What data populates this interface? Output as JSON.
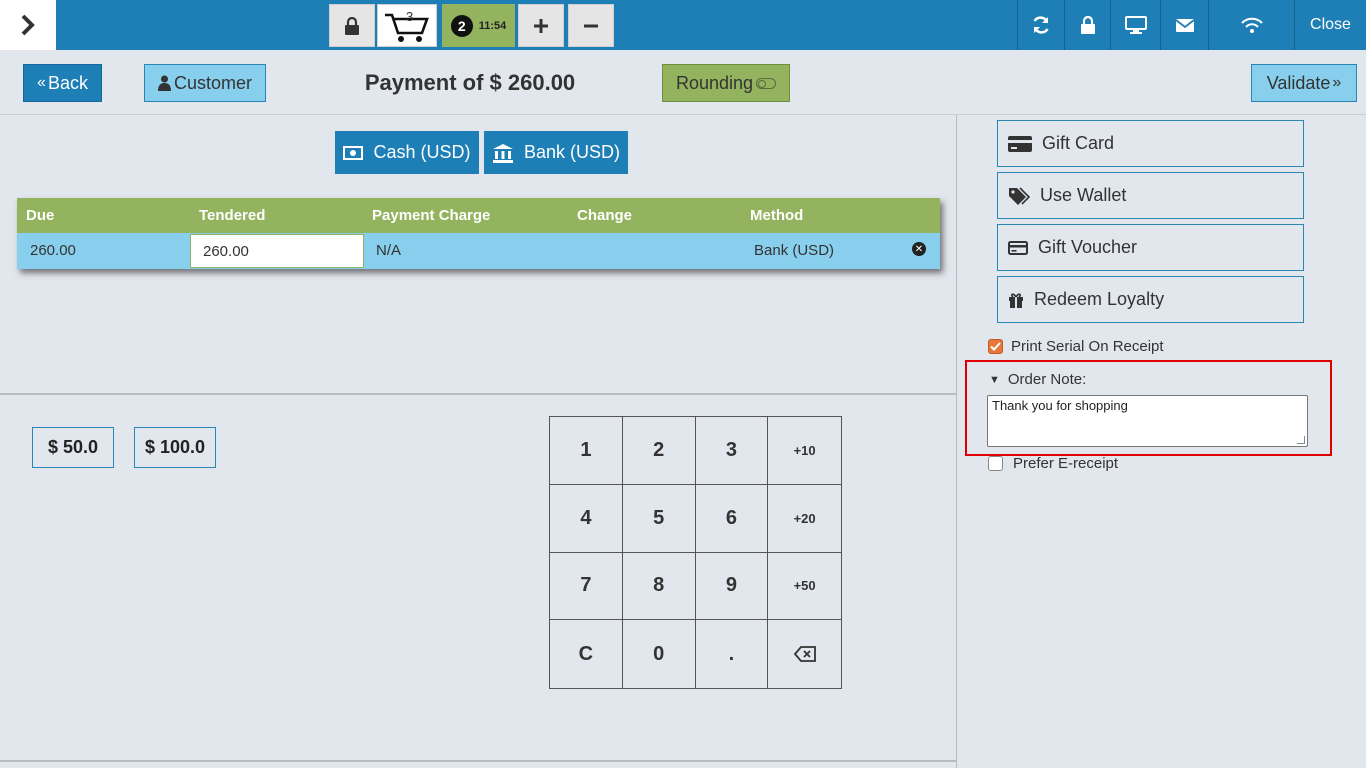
{
  "topbar": {
    "cart_count": "3",
    "order_number": "2",
    "order_time": "11:54",
    "close_label": "Close",
    "icons": [
      "chevron-right-icon",
      "lock-icon",
      "cart-icon",
      "plus-icon",
      "minus-icon",
      "refresh-icon",
      "lock-icon",
      "monitor-icon",
      "mail-icon",
      "wifi-icon"
    ],
    "color": "#1d7fb5"
  },
  "header": {
    "back_label": "Back",
    "customer_label": "Customer",
    "title": "Payment of $ 260.00",
    "rounding_label": "Rounding",
    "validate_label": "Validate"
  },
  "methods": [
    {
      "label": "Cash (USD)",
      "icon": "cash-icon"
    },
    {
      "label": "Bank (USD)",
      "icon": "bank-icon"
    }
  ],
  "payment_table": {
    "headers": [
      "Due",
      "Tendered",
      "Payment Charge",
      "Change",
      "Method"
    ],
    "row": {
      "due": "260.00",
      "tendered": "260.00",
      "charge": "N/A",
      "change": "",
      "method": "Bank (USD)"
    }
  },
  "quick_amounts": [
    "$ 50.0",
    "$ 100.0"
  ],
  "numpad": [
    "1",
    "2",
    "3",
    "+10",
    "4",
    "5",
    "6",
    "+20",
    "7",
    "8",
    "9",
    "+50",
    "C",
    "0",
    ".",
    "⌫"
  ],
  "right_panel": {
    "buttons": [
      "Gift Card",
      "Use Wallet",
      "Gift Voucher",
      "Redeem Loyalty"
    ],
    "print_serial_label": "Print Serial On Receipt",
    "print_serial_checked": true,
    "order_note_label": "Order Note:",
    "order_note_value": "Thank you for shopping",
    "prefer_ereceipt_label": "Prefer E-receipt",
    "prefer_ereceipt_checked": false
  },
  "colors": {
    "accent": "#1d7fb5",
    "green": "#93b35e",
    "light_blue": "#87cfec",
    "highlight": "#e00000"
  }
}
